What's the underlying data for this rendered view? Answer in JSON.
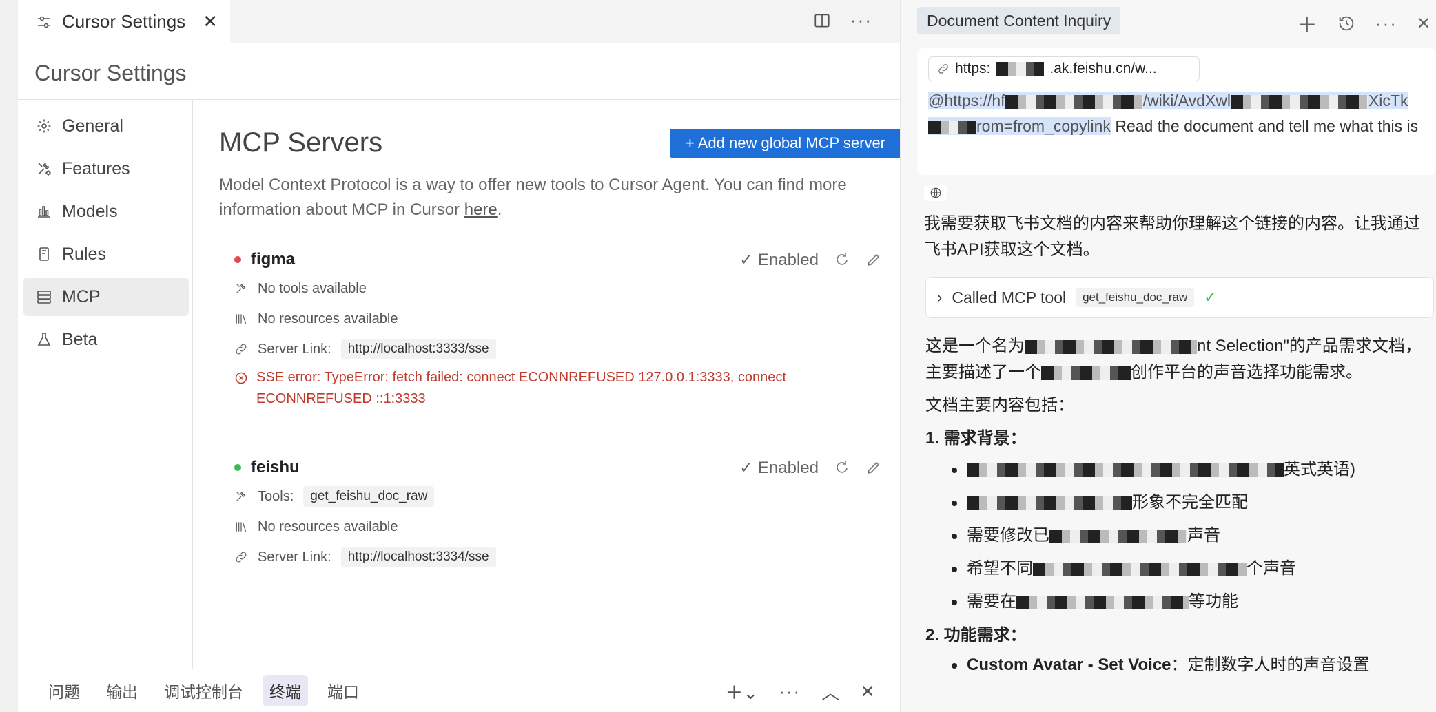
{
  "tab": {
    "title": "Cursor Settings"
  },
  "page": {
    "title": "Cursor Settings"
  },
  "sidebar": {
    "items": [
      {
        "label": "General",
        "icon": "gear-icon"
      },
      {
        "label": "Features",
        "icon": "tools-icon"
      },
      {
        "label": "Models",
        "icon": "bar-chart-icon"
      },
      {
        "label": "Rules",
        "icon": "book-icon"
      },
      {
        "label": "MCP",
        "icon": "server-icon"
      },
      {
        "label": "Beta",
        "icon": "flask-icon"
      }
    ],
    "active": "MCP"
  },
  "mcp": {
    "title": "MCP Servers",
    "add_button": "+ Add new global MCP server",
    "description_before": "Model Context Protocol is a way to offer new tools to Cursor Agent. You can find more information about MCP in Cursor ",
    "description_link": "here",
    "description_after": ".",
    "servers": [
      {
        "name": "figma",
        "status_color": "#e5484d",
        "enabled_label": "✓ Enabled",
        "tools_text": "No tools available",
        "resources_text": "No resources available",
        "server_link_label": "Server Link:",
        "server_link": "http://localhost:3333/sse",
        "error": "SSE error: TypeError: fetch failed: connect ECONNREFUSED 127.0.0.1:3333, connect ECONNREFUSED ::1:3333"
      },
      {
        "name": "feishu",
        "status_color": "#3fb950",
        "enabled_label": "✓ Enabled",
        "tools_label": "Tools:",
        "tool_name": "get_feishu_doc_raw",
        "resources_text": "No resources available",
        "server_link_label": "Server Link:",
        "server_link": "http://localhost:3334/sse"
      }
    ]
  },
  "bottom_panel": {
    "tabs": [
      "问题",
      "输出",
      "调试控制台",
      "终端",
      "端口"
    ],
    "active": "终端"
  },
  "chat": {
    "title": "Document Content Inquiry",
    "url_chip": "https:",
    "url_chip_tail": ".ak.feishu.cn/w...",
    "prompt_link_1": "@https://hf",
    "prompt_link_2": "/wiki/AvdXwl",
    "prompt_link_3": "XicTk",
    "prompt_link_4": "rom=from_copylink",
    "prompt_text": "Read the document and tell me what this is",
    "assistant_intro": "我需要获取飞书文档的内容来帮助你理解这个链接的内容。让我通过飞书API获取这个文档。",
    "tool_call_label": "Called MCP tool",
    "tool_call_name": "get_feishu_doc_raw",
    "summary_1a": "这是一个名为",
    "summary_1b": "nt Selection\"的产品需求文档，主要描述了一个",
    "summary_1c": "创作平台的声音选择功能需求。",
    "summary_2": "文档主要内容包括：",
    "section_1": "1. 需求背景：",
    "bullets_1": [
      {
        "before": "",
        "after": "英式英语)"
      },
      {
        "before": "",
        "after": "形象不完全匹配"
      },
      {
        "before": "需要修改已",
        "after": "声音"
      },
      {
        "before": "希望不同",
        "after": "个声音"
      },
      {
        "before": "需要在",
        "after": "等功能"
      }
    ],
    "section_2": "2. 功能需求：",
    "feature_bold": "Custom Avatar - Set Voice",
    "feature_text": "：定制数字人时的声音设置"
  }
}
